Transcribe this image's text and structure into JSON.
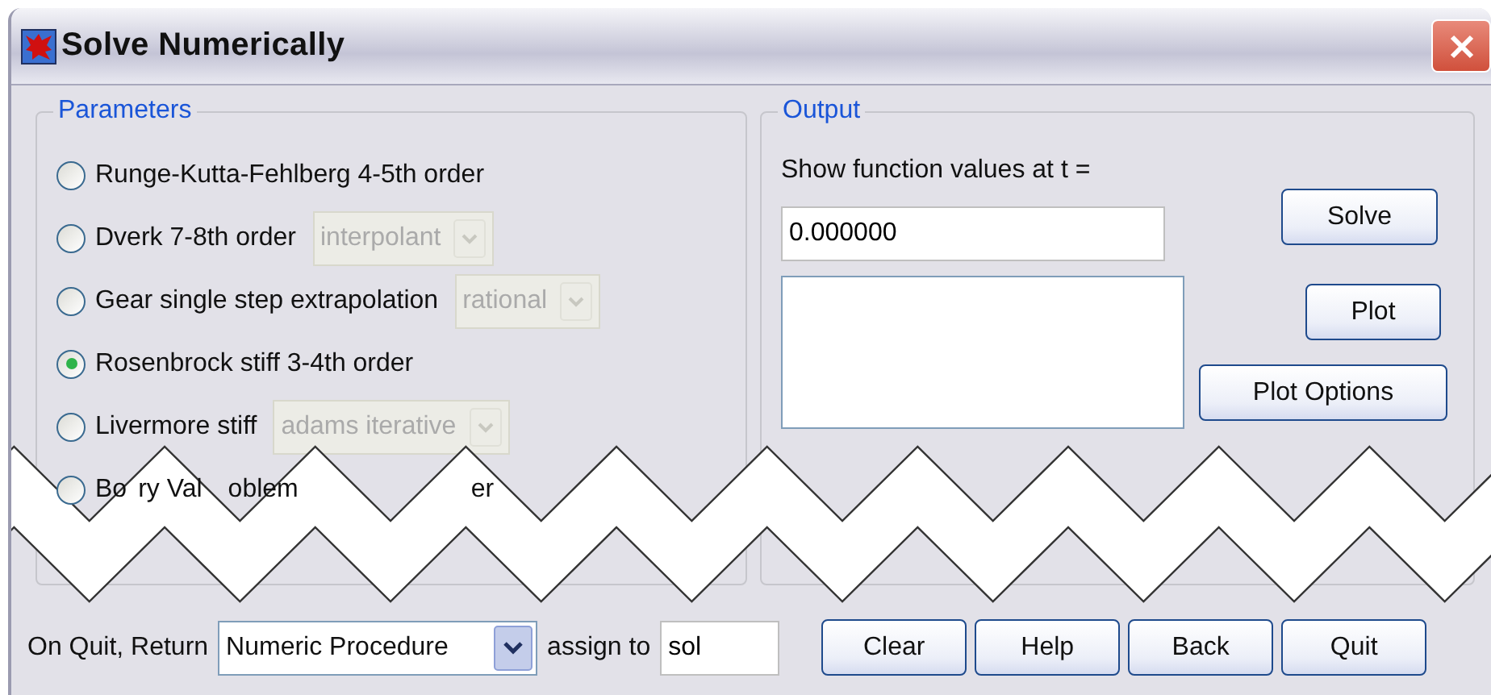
{
  "window": {
    "title": "Solve Numerically"
  },
  "parameters": {
    "title": "Parameters",
    "methods": [
      {
        "label": "Runge-Kutta-Fehlberg 4-5th order",
        "selected": false
      },
      {
        "label": "Dverk 7-8th order",
        "selected": false,
        "option": {
          "value": "interpolant",
          "disabled": true
        }
      },
      {
        "label": "Gear single step extrapolation",
        "selected": false,
        "option": {
          "value": "rational",
          "disabled": true
        }
      },
      {
        "label": "Rosenbrock stiff 3-4th order",
        "selected": true
      },
      {
        "label": "Livermore stiff",
        "selected": false,
        "option": {
          "value": "adams iterative",
          "disabled": true
        }
      },
      {
        "label_fragments": [
          "Bo",
          "ry Val",
          "oblem",
          "er"
        ],
        "selected": false
      }
    ]
  },
  "output": {
    "title": "Output",
    "prompt": "Show function values at t =",
    "t_value": "0.000000",
    "buttons": [
      "Solve",
      "Plot",
      "Plot Options"
    ]
  },
  "footer": {
    "return_label": "On Quit, Return",
    "return_type": "Numeric Procedure",
    "assign_label": "assign to",
    "assign_value": "sol",
    "buttons": [
      "Clear",
      "Help",
      "Back",
      "Quit"
    ]
  }
}
